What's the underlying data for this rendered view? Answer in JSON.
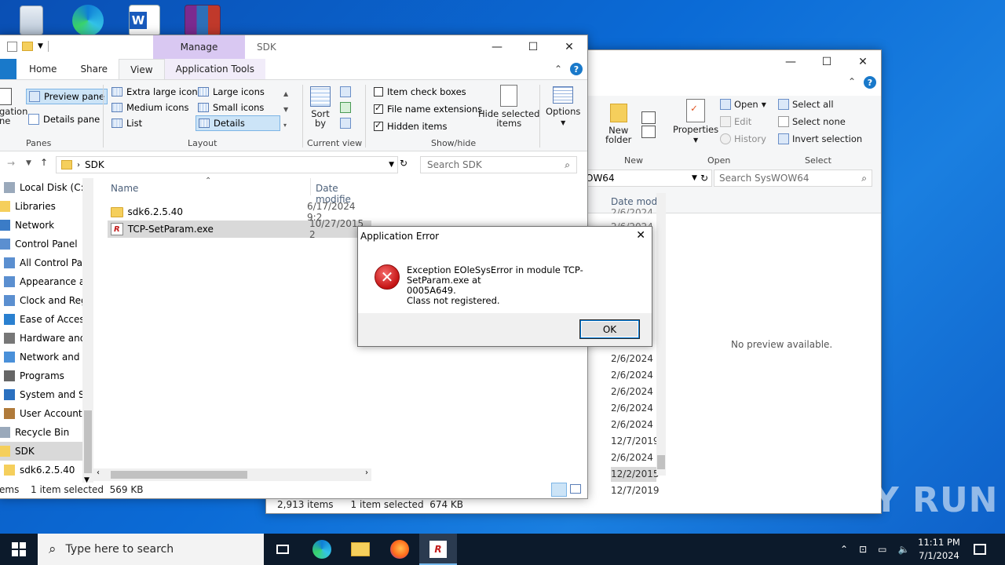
{
  "colors": {
    "accent": "#1979ca",
    "manage_tab": "#d9c8f2",
    "error": "#c41313",
    "taskbar": "#0c1a2b"
  },
  "desktop_icons": [
    "recycle-bin-icon",
    "edge-icon",
    "word-icon",
    "winrar-icon"
  ],
  "back_window": {
    "ribbon": {
      "new_folder": "New\nfolder",
      "new_group": "New",
      "properties": "Properties",
      "open": "Open",
      "edit": "Edit",
      "history": "History",
      "open_group": "Open",
      "select_all": "Select all",
      "select_none": "Select none",
      "invert_selection": "Invert selection",
      "select_group": "Select"
    },
    "address": "OW64",
    "search_placeholder": "Search SysWOW64",
    "date_header": "Date mod",
    "dates": [
      "2/6/2024",
      "2/6/2024",
      "2/6/2024",
      "2/6/2024",
      "2/6/2024",
      "12/7/2019",
      "2/6/2024",
      "12/2/2015",
      "12/7/2019"
    ],
    "top_dates": [
      "2/6/2024",
      "2/6/2024"
    ],
    "preview_text": "No preview available.",
    "status_items": "2,913 items",
    "status_selected": "1 item selected  674 KB"
  },
  "front_window": {
    "manage_label": "Manage",
    "title": "SDK",
    "tabs": {
      "home": "Home",
      "share": "Share",
      "view": "View",
      "app_tools": "Application Tools"
    },
    "ribbon": {
      "navigation_pane": "gation\nne",
      "preview_pane": "Preview pane",
      "details_pane": "Details pane",
      "panes_group": "Panes",
      "extra_large": "Extra large icons",
      "large": "Large icons",
      "medium": "Medium icons",
      "small": "Small icons",
      "list": "List",
      "details": "Details",
      "layout_group": "Layout",
      "sort_by": "Sort\nby",
      "current_view_group": "Current view",
      "item_check_boxes": "Item check boxes",
      "file_name_extensions": "File name extensions",
      "hidden_items": "Hidden items",
      "hide_selected": "Hide selected\nitems",
      "show_hide_group": "Show/hide",
      "options": "Options"
    },
    "address": "SDK",
    "search_placeholder": "Search SDK",
    "nav_items": [
      {
        "label": "Local Disk (C:)"
      },
      {
        "label": "Libraries"
      },
      {
        "label": "Network"
      },
      {
        "label": "Control Panel"
      },
      {
        "label": "All Control Par"
      },
      {
        "label": "Appearance an"
      },
      {
        "label": "Clock and Regi"
      },
      {
        "label": "Ease of Access"
      },
      {
        "label": "Hardware and"
      },
      {
        "label": "Network and Ir"
      },
      {
        "label": "Programs"
      },
      {
        "label": "System and Se"
      },
      {
        "label": "User Accounts"
      },
      {
        "label": "Recycle Bin"
      },
      {
        "label": "SDK"
      },
      {
        "label": "sdk6.2.5.40"
      }
    ],
    "columns": {
      "name": "Name",
      "date": "Date modifie"
    },
    "files": [
      {
        "name": "sdk6.2.5.40",
        "date": "6/17/2024 9:2"
      },
      {
        "name": "TCP-SetParam.exe",
        "date": "10/27/2015 2"
      }
    ],
    "status_left": "ems",
    "status_selected": "1 item selected  569 KB"
  },
  "dialog": {
    "title": "Application Error",
    "message_line1": "Exception EOleSysError in module TCP-SetParam.exe at",
    "message_line2": "0005A649.",
    "message_line3": "Class not registered.",
    "ok": "OK"
  },
  "taskbar": {
    "search_placeholder": "Type here to search",
    "time": "11:11 PM",
    "date": "7/1/2024"
  },
  "watermark": "ANY RUN"
}
